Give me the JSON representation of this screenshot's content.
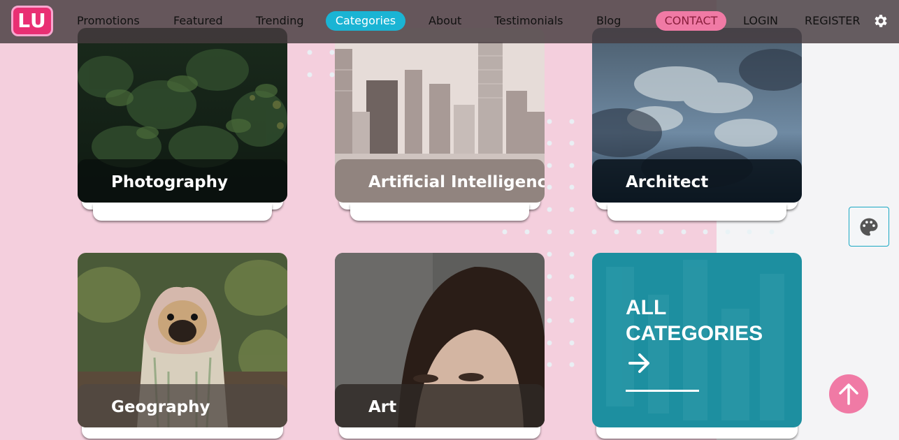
{
  "logo": "LU",
  "nav": {
    "items": [
      "Promotions",
      "Featured",
      "Trending",
      "Categories",
      "About",
      "Testimonials",
      "Blog"
    ],
    "active": "Categories",
    "contact": "CONTACT",
    "login": "LOGIN",
    "register": "REGISTER"
  },
  "cards": [
    {
      "label": "Photography"
    },
    {
      "label": "Artificial Intelligence"
    },
    {
      "label": "Architect"
    },
    {
      "label": "Geography"
    },
    {
      "label": "Art"
    }
  ],
  "all_categories": {
    "title": "ALL CATEGORIES",
    "arrow": "→"
  },
  "icons": {
    "settings": "gear-icon",
    "palette": "palette-icon",
    "scroll_top": "arrow-up-icon",
    "arrow": "arrow-right-icon"
  },
  "colors": {
    "background": "#f4cfdd",
    "accent_cyan": "#1ab4d4",
    "accent_pink": "#f07aa5",
    "teal_card": "#1d8fa0"
  }
}
